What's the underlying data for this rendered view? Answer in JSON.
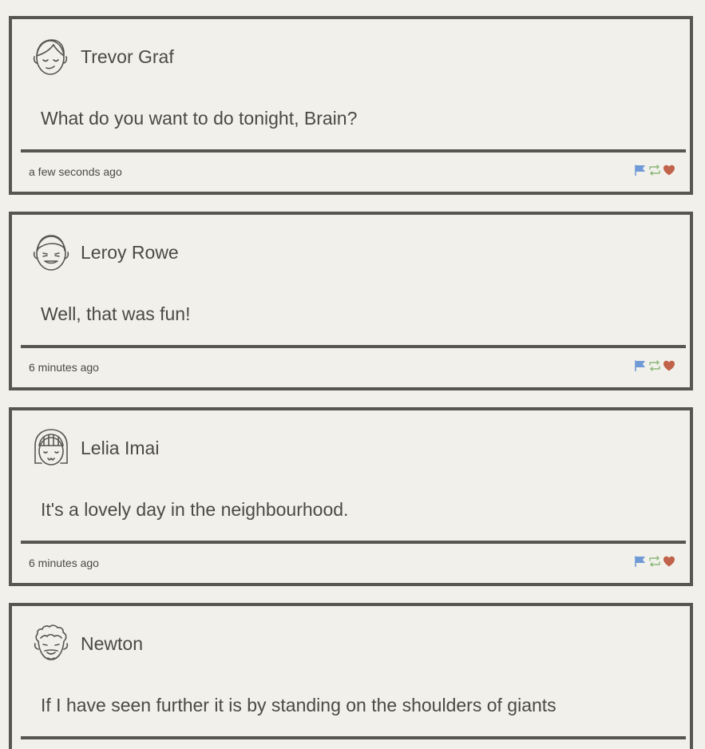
{
  "colors": {
    "background": "#f2f0eb",
    "border": "#575751",
    "text": "#4a4a45",
    "flag": "#6f9ad6",
    "retweet": "#8cb87a",
    "heart": "#c0634a"
  },
  "posts": [
    {
      "avatar_icon": "smiling-face-side-part-icon",
      "user": "Trevor Graf",
      "message": "What do you want to do tonight, Brain?",
      "time": "a few seconds ago"
    },
    {
      "avatar_icon": "grinning-face-icon",
      "user": "Leroy Rowe",
      "message": "Well, that was fun!",
      "time": "6 minutes ago"
    },
    {
      "avatar_icon": "face-with-bangs-icon",
      "user": "Lelia Imai",
      "message": "It's a lovely day in the neighbourhood.",
      "time": "6 minutes ago"
    },
    {
      "avatar_icon": "curly-hair-face-icon",
      "user": "Newton",
      "message": "If I have seen further it is by standing on the shoulders of giants",
      "time": ""
    }
  ],
  "action_icons": [
    "flag-icon",
    "retweet-icon",
    "heart-icon"
  ]
}
